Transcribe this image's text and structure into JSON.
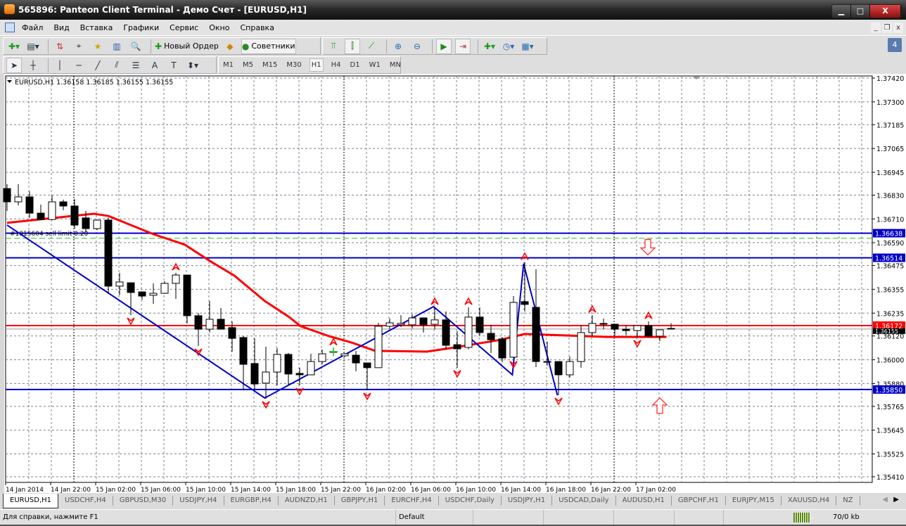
{
  "window": {
    "title": "565896: Panteon Client Terminal - Демо Счет - [EURUSD,H1]",
    "minimize": "▁",
    "maximize": "□",
    "close": "X"
  },
  "menu": {
    "items": [
      "Файл",
      "Вид",
      "Вставка",
      "Графики",
      "Сервис",
      "Окно",
      "Справка"
    ],
    "mdi": [
      "_",
      "❐",
      "x"
    ]
  },
  "toolbar": {
    "new_order": "Новый Ордер",
    "experts": "Советники",
    "alerts_count": "4",
    "timeframes": [
      "M1",
      "M5",
      "M15",
      "M30",
      "H1",
      "H4",
      "D1",
      "W1",
      "MN"
    ],
    "active_timeframe": "H1"
  },
  "chart": {
    "legend": "EURUSD,H1  1.36158 1.36185 1.36155 1.36155",
    "order_label": "#1815604 sell limit 0.20",
    "order_price": 1.36612,
    "price_axis": [
      "1.37420",
      "1.37300",
      "1.37185",
      "1.37065",
      "1.36945",
      "1.36830",
      "1.36710",
      "1.36590",
      "1.36475",
      "1.36355",
      "1.36235",
      "1.36120",
      "1.36000",
      "1.35880",
      "1.35765",
      "1.35645",
      "1.35525",
      "1.35410"
    ],
    "price_range": [
      1.3541,
      1.3742
    ],
    "time_axis": [
      "14 Jan 2014",
      "14 Jan 22:00",
      "15 Jan 02:00",
      "15 Jan 06:00",
      "15 Jan 10:00",
      "15 Jan 14:00",
      "15 Jan 18:00",
      "15 Jan 22:00",
      "16 Jan 02:00",
      "16 Jan 06:00",
      "16 Jan 10:00",
      "16 Jan 14:00",
      "16 Jan 18:00",
      "16 Jan 22:00",
      "17 Jan 02:00"
    ],
    "hlines": [
      {
        "price": "1.36638",
        "color": "#0000c8",
        "label_bg": "#0000c8"
      },
      {
        "price": "1.36514",
        "color": "#0000c8",
        "label_bg": "#0000c8"
      },
      {
        "price": "1.35850",
        "color": "#0000c8",
        "label_bg": "#0000c8"
      },
      {
        "price": "1.36172",
        "color": "#ff0000",
        "label_bg": "#ff0000"
      }
    ],
    "bid": "1.36155",
    "candles": [
      [
        1.36863,
        1.36885,
        1.3675,
        1.36796
      ],
      [
        1.36796,
        1.36885,
        1.36778,
        1.36821
      ],
      [
        1.36821,
        1.36849,
        1.36715,
        1.36739
      ],
      [
        1.36739,
        1.36782,
        1.36704,
        1.36707
      ],
      [
        1.36707,
        1.36828,
        1.36704,
        1.36796
      ],
      [
        1.36796,
        1.36807,
        1.36754,
        1.36775
      ],
      [
        1.36775,
        1.3681,
        1.36661,
        1.36679
      ],
      [
        1.36715,
        1.3675,
        1.36644,
        1.36661
      ],
      [
        1.36661,
        1.36707,
        1.36654,
        1.36704
      ],
      [
        1.36704,
        1.36715,
        1.36332,
        1.36371
      ],
      [
        1.36371,
        1.36438,
        1.36325,
        1.36392
      ],
      [
        1.36388,
        1.36388,
        1.36225,
        1.36339
      ],
      [
        1.36342,
        1.36342,
        1.36303,
        1.36321
      ],
      [
        1.36325,
        1.36385,
        1.36282,
        1.36335
      ],
      [
        1.36335,
        1.36396,
        1.36332,
        1.36385
      ],
      [
        1.36385,
        1.36438,
        1.36307,
        1.36427
      ],
      [
        1.36427,
        1.36427,
        1.36183,
        1.36222
      ],
      [
        1.36222,
        1.36236,
        1.36069,
        1.36154
      ],
      [
        1.36154,
        1.36296,
        1.36137,
        1.36204
      ],
      [
        1.36204,
        1.36261,
        1.36154,
        1.36154
      ],
      [
        1.36162,
        1.36193,
        1.36041,
        1.36108
      ],
      [
        1.36112,
        1.36119,
        1.35846,
        1.35977
      ],
      [
        1.35981,
        1.36108,
        1.35846,
        1.35878
      ],
      [
        1.35882,
        1.36066,
        1.35804,
        1.35938
      ],
      [
        1.35938,
        1.36059,
        1.35871,
        1.36027
      ],
      [
        1.36027,
        1.36034,
        1.35871,
        1.35928
      ],
      [
        1.35931,
        1.3596,
        1.35871,
        1.35924
      ],
      [
        1.35924,
        1.3603,
        1.35924,
        1.35991
      ],
      [
        1.35991,
        1.36052,
        1.35977,
        1.3603
      ],
      [
        1.36041,
        1.3606,
        1.3602,
        1.36041
      ],
      [
        1.3602,
        1.36034,
        1.36013,
        1.3603
      ],
      [
        1.36023,
        1.36045,
        1.35942,
        1.35984
      ],
      [
        1.35984,
        1.35984,
        1.35846,
        1.3596
      ],
      [
        1.3596,
        1.36186,
        1.3596,
        1.36169
      ],
      [
        1.36169,
        1.36208,
        1.36154,
        1.36186
      ],
      [
        1.36176,
        1.36225,
        1.36165,
        1.36183
      ],
      [
        1.36176,
        1.36229,
        1.36158,
        1.36211
      ],
      [
        1.36211,
        1.36211,
        1.36137,
        1.36176
      ],
      [
        1.36179,
        1.36264,
        1.36154,
        1.36201
      ],
      [
        1.36201,
        1.36243,
        1.36052,
        1.36073
      ],
      [
        1.36076,
        1.36144,
        1.3596,
        1.36055
      ],
      [
        1.36062,
        1.36264,
        1.36052,
        1.36215
      ],
      [
        1.36215,
        1.36264,
        1.36123,
        1.36137
      ],
      [
        1.36133,
        1.36176,
        1.36034,
        1.36101
      ],
      [
        1.36105,
        1.36115,
        1.35988,
        1.36009
      ],
      [
        1.36013,
        1.36321,
        1.36006,
        1.36289
      ],
      [
        1.36293,
        1.36491,
        1.36243,
        1.36279
      ],
      [
        1.36264,
        1.36456,
        1.35963,
        1.35991
      ],
      [
        1.35991,
        1.36091,
        1.3597,
        1.35988
      ],
      [
        1.35991,
        1.35991,
        1.35821,
        1.35924
      ],
      [
        1.35924,
        1.36016,
        1.3591,
        1.35991
      ],
      [
        1.35991,
        1.36172,
        1.3596,
        1.36137
      ],
      [
        1.36137,
        1.36225,
        1.36119,
        1.36183
      ],
      [
        1.36183,
        1.36208,
        1.36154,
        1.36179
      ],
      [
        1.36179,
        1.36179,
        1.36123,
        1.36154
      ],
      [
        1.36154,
        1.36172,
        1.36123,
        1.36147
      ],
      [
        1.36147,
        1.36172,
        1.36112,
        1.36172
      ],
      [
        1.36172,
        1.36193,
        1.36112,
        1.36119
      ],
      [
        1.36119,
        1.36151,
        1.36094,
        1.36151
      ],
      [
        1.36158,
        1.36185,
        1.36155,
        1.36155
      ]
    ],
    "ma": [
      [
        0,
        1.3669
      ],
      [
        7.7,
        1.36736
      ],
      [
        9,
        1.36725
      ],
      [
        13,
        1.36633
      ],
      [
        15.8,
        1.3658
      ],
      [
        18.1,
        1.36495
      ],
      [
        20.2,
        1.36424
      ],
      [
        22.9,
        1.36296
      ],
      [
        25,
        1.36218
      ],
      [
        26.1,
        1.36169
      ],
      [
        28.6,
        1.36119
      ],
      [
        30.6,
        1.36087
      ],
      [
        32.7,
        1.36045
      ],
      [
        37.3,
        1.36041
      ],
      [
        39.8,
        1.36062
      ],
      [
        43.9,
        1.36101
      ],
      [
        46,
        1.3613
      ],
      [
        49.4,
        1.36123
      ],
      [
        53.3,
        1.36115
      ],
      [
        58.6,
        1.36115
      ]
    ],
    "zigzag": [
      [
        0,
        1.36679
      ],
      [
        22.9,
        1.35807
      ],
      [
        37.9,
        1.36268
      ],
      [
        44.9,
        1.35924
      ],
      [
        45.9,
        1.36484
      ],
      [
        48.9,
        1.35821
      ]
    ],
    "fractals_up": [
      15,
      29,
      38,
      41,
      46,
      52,
      57
    ],
    "fractals_down": [
      11,
      17,
      23,
      26,
      32,
      40,
      45,
      49,
      56
    ],
    "signal_sell_bar": 57,
    "signal_buy_bar": 58,
    "colors": {
      "zigzag": "#0000c8",
      "ma": "#ff0000",
      "grid": "#7a8290",
      "fractal": "#ff0000"
    }
  },
  "tabs": [
    "EURUSD,H1",
    "USDCHF,H4",
    "GBPUSD,M30",
    "USDJPY,H4",
    "EURGBP,H4",
    "AUDNZD,H1",
    "GBPJPY,H1",
    "EURCHF,H4",
    "USDCHF,Daily",
    "USDJPY,H1",
    "USDCAD,Daily",
    "AUDUSD,H1",
    "GBPCHF,H1",
    "EURJPY,M15",
    "XAUUSD,H4",
    "NZ"
  ],
  "status": {
    "help": "Для справки, нажмите F1",
    "profile": "Default",
    "traffic": "70/0 kb"
  }
}
